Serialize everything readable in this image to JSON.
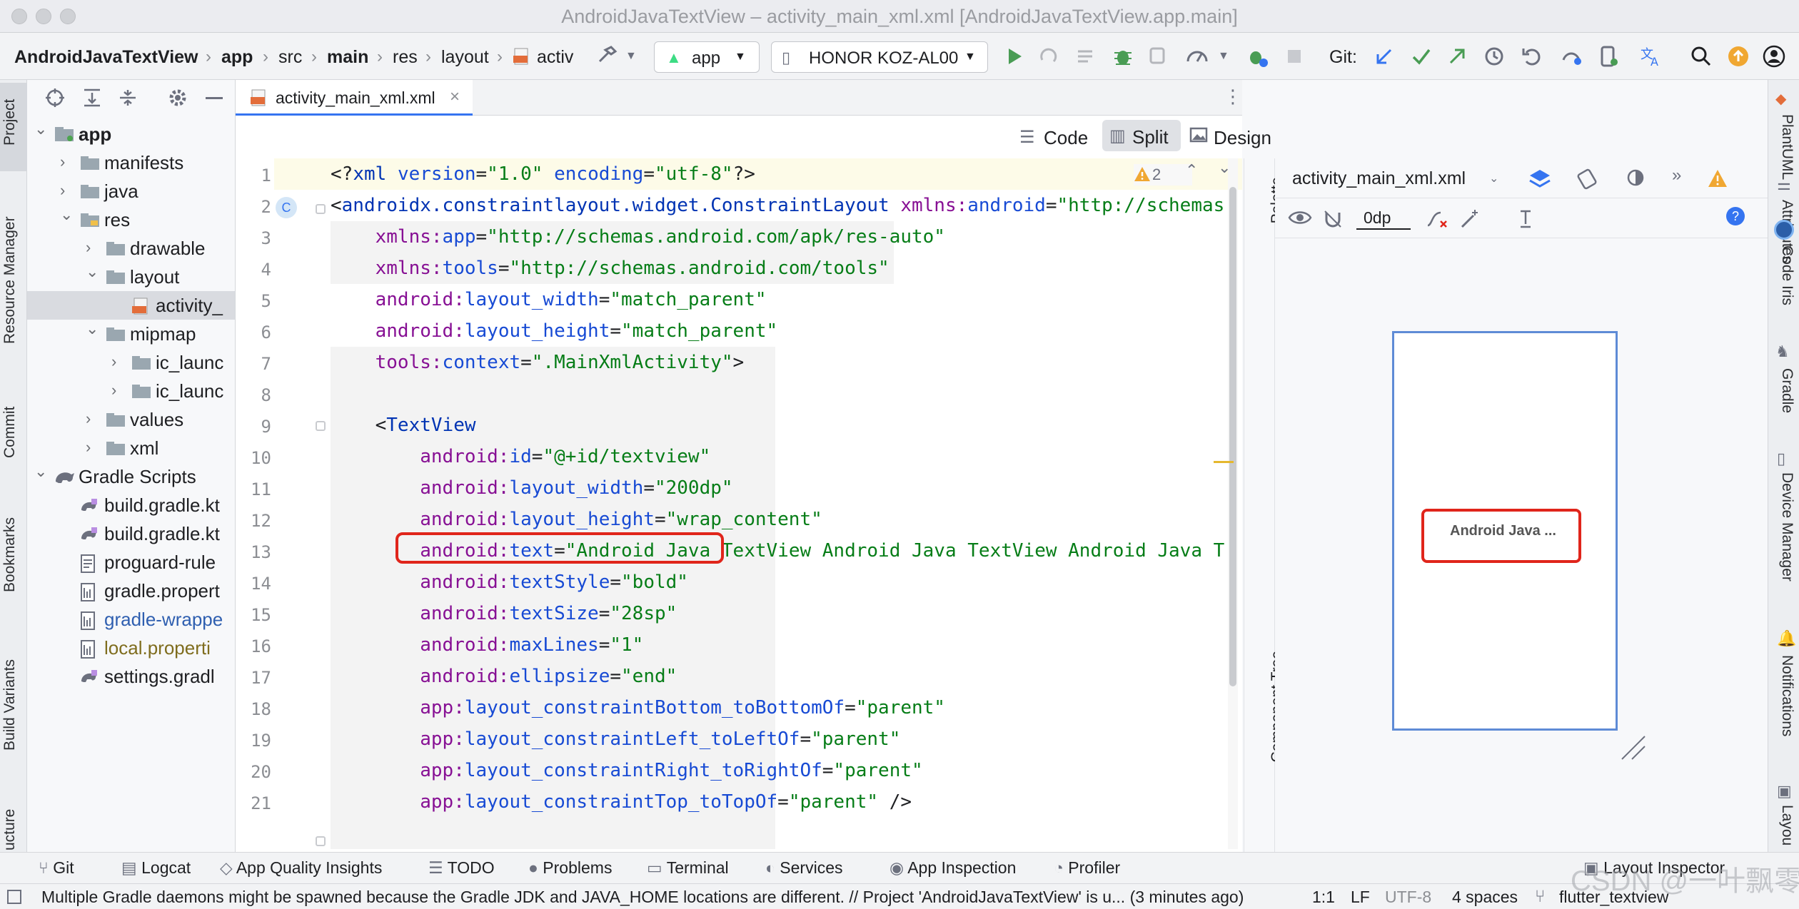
{
  "window": {
    "title": "AndroidJavaTextView – activity_main_xml.xml [AndroidJavaTextView.app.main]"
  },
  "toolbar": {
    "breadcrumbs": [
      "AndroidJavaTextView",
      "app",
      "src",
      "main",
      "res",
      "layout",
      "activ"
    ],
    "run_config": "app",
    "device": "HONOR KOZ-AL00",
    "git_label": "Git:"
  },
  "left_tools": [
    "Project",
    "Resource Manager",
    "Commit",
    "Bookmarks",
    "Build Variants",
    "ucture"
  ],
  "right_tools": [
    "PlantUML",
    "Attributes",
    "Code Iris",
    "Gradle",
    "Device Manager",
    "Notifications",
    "Layou"
  ],
  "project_tree": [
    {
      "label": "app",
      "depth": 0,
      "arrow": "down",
      "icon": "module-folder-icon",
      "bold": true
    },
    {
      "label": "manifests",
      "depth": 1,
      "arrow": "right",
      "icon": "folder-icon"
    },
    {
      "label": "java",
      "depth": 1,
      "arrow": "right",
      "icon": "folder-icon"
    },
    {
      "label": "res",
      "depth": 1,
      "arrow": "down",
      "icon": "res-folder-icon"
    },
    {
      "label": "drawable",
      "depth": 2,
      "arrow": "right",
      "icon": "folder-icon"
    },
    {
      "label": "layout",
      "depth": 2,
      "arrow": "down",
      "icon": "folder-icon"
    },
    {
      "label": "activity_",
      "depth": 3,
      "arrow": "",
      "icon": "xml-file-icon",
      "selected": true
    },
    {
      "label": "mipmap",
      "depth": 2,
      "arrow": "down",
      "icon": "folder-icon"
    },
    {
      "label": "ic_launc",
      "depth": 3,
      "arrow": "right",
      "icon": "folder-icon"
    },
    {
      "label": "ic_launc",
      "depth": 3,
      "arrow": "right",
      "icon": "folder-icon"
    },
    {
      "label": "values",
      "depth": 2,
      "arrow": "right",
      "icon": "folder-icon"
    },
    {
      "label": "xml",
      "depth": 2,
      "arrow": "right",
      "icon": "folder-icon"
    },
    {
      "label": "Gradle Scripts",
      "depth": 0,
      "arrow": "down",
      "icon": "gradle-icon"
    },
    {
      "label": "build.gradle.kt",
      "depth": 1,
      "arrow": "",
      "icon": "gradle-file-icon"
    },
    {
      "label": "build.gradle.kt",
      "depth": 1,
      "arrow": "",
      "icon": "gradle-file-icon"
    },
    {
      "label": "proguard-rule",
      "depth": 1,
      "arrow": "",
      "icon": "text-file-icon"
    },
    {
      "label": "gradle.propert",
      "depth": 1,
      "arrow": "",
      "icon": "properties-file-icon"
    },
    {
      "label": "gradle-wrappe",
      "depth": 1,
      "arrow": "",
      "icon": "properties-file-icon",
      "color": "#2f5fb0"
    },
    {
      "label": "local.properti",
      "depth": 1,
      "arrow": "",
      "icon": "properties-file-icon",
      "color": "#7f6d1e"
    },
    {
      "label": "settings.gradl",
      "depth": 1,
      "arrow": "",
      "icon": "gradle-file-icon"
    }
  ],
  "editor": {
    "tab_label": "activity_main_xml.xml",
    "view_modes": {
      "code": "Code",
      "split": "Split",
      "design": "Design"
    },
    "active_mode": "Split",
    "warning_count": "2",
    "lines": [
      [
        [
          "plain",
          "<?"
        ],
        [
          "tag",
          "xml "
        ],
        [
          "attr",
          "version"
        ],
        [
          "plain",
          "="
        ],
        [
          "val",
          "\"1.0\""
        ],
        [
          "attr",
          " encoding"
        ],
        [
          "plain",
          "="
        ],
        [
          "val",
          "\"utf-8\""
        ],
        [
          "plain",
          "?>"
        ]
      ],
      [
        [
          "plain",
          "<"
        ],
        [
          "tag",
          "androidx.constraintlayout.widget.ConstraintLayout "
        ],
        [
          "ns",
          "xmlns:"
        ],
        [
          "attr",
          "android"
        ],
        [
          "plain",
          "="
        ],
        [
          "val",
          "\"http://schemas"
        ]
      ],
      [
        [
          "plain",
          "    "
        ],
        [
          "ns",
          "xmlns:"
        ],
        [
          "attr",
          "app"
        ],
        [
          "plain",
          "="
        ],
        [
          "val",
          "\"http://schemas.android.com/apk/res-auto\""
        ]
      ],
      [
        [
          "plain",
          "    "
        ],
        [
          "ns",
          "xmlns:"
        ],
        [
          "attr",
          "tools"
        ],
        [
          "plain",
          "="
        ],
        [
          "val",
          "\"http://schemas.android.com/tools\""
        ]
      ],
      [
        [
          "plain",
          "    "
        ],
        [
          "ns",
          "android:"
        ],
        [
          "attr",
          "layout_width"
        ],
        [
          "plain",
          "="
        ],
        [
          "val",
          "\"match_parent\""
        ]
      ],
      [
        [
          "plain",
          "    "
        ],
        [
          "ns",
          "android:"
        ],
        [
          "attr",
          "layout_height"
        ],
        [
          "plain",
          "="
        ],
        [
          "val",
          "\"match_parent\""
        ]
      ],
      [
        [
          "plain",
          "    "
        ],
        [
          "ns",
          "tools:"
        ],
        [
          "attr",
          "context"
        ],
        [
          "plain",
          "="
        ],
        [
          "val",
          "\".MainXmlActivity\""
        ],
        [
          "plain",
          ">"
        ]
      ],
      [
        [
          "plain",
          ""
        ]
      ],
      [
        [
          "plain",
          "    <"
        ],
        [
          "tag",
          "TextView"
        ]
      ],
      [
        [
          "plain",
          "        "
        ],
        [
          "ns",
          "android:"
        ],
        [
          "attr",
          "id"
        ],
        [
          "plain",
          "="
        ],
        [
          "val",
          "\"@+id/textview\""
        ]
      ],
      [
        [
          "plain",
          "        "
        ],
        [
          "ns",
          "android:"
        ],
        [
          "attr",
          "layout_width"
        ],
        [
          "plain",
          "="
        ],
        [
          "val",
          "\"200dp\""
        ]
      ],
      [
        [
          "plain",
          "        "
        ],
        [
          "ns",
          "android:"
        ],
        [
          "attr",
          "layout_height"
        ],
        [
          "plain",
          "="
        ],
        [
          "val",
          "\"wrap_content\""
        ]
      ],
      [
        [
          "plain",
          "        "
        ],
        [
          "ns",
          "android:"
        ],
        [
          "attr",
          "text"
        ],
        [
          "plain",
          "="
        ],
        [
          "val",
          "\"Android Java TextView Android Java TextView Android Java T"
        ]
      ],
      [
        [
          "plain",
          "        "
        ],
        [
          "ns",
          "android:"
        ],
        [
          "attr",
          "textStyle"
        ],
        [
          "plain",
          "="
        ],
        [
          "val",
          "\"bold\""
        ]
      ],
      [
        [
          "plain",
          "        "
        ],
        [
          "ns",
          "android:"
        ],
        [
          "attr",
          "textSize"
        ],
        [
          "plain",
          "="
        ],
        [
          "val",
          "\"28sp\""
        ]
      ],
      [
        [
          "plain",
          "        "
        ],
        [
          "ns",
          "android:"
        ],
        [
          "attr",
          "maxLines"
        ],
        [
          "plain",
          "="
        ],
        [
          "val",
          "\"1\""
        ]
      ],
      [
        [
          "plain",
          "        "
        ],
        [
          "ns",
          "android:"
        ],
        [
          "attr",
          "ellipsize"
        ],
        [
          "plain",
          "="
        ],
        [
          "val",
          "\"end\""
        ]
      ],
      [
        [
          "plain",
          "        "
        ],
        [
          "ns",
          "app:"
        ],
        [
          "attr",
          "layout_constraintBottom_toBottomOf"
        ],
        [
          "plain",
          "="
        ],
        [
          "val",
          "\"parent\""
        ]
      ],
      [
        [
          "plain",
          "        "
        ],
        [
          "ns",
          "app:"
        ],
        [
          "attr",
          "layout_constraintLeft_toLeftOf"
        ],
        [
          "plain",
          "="
        ],
        [
          "val",
          "\"parent\""
        ]
      ],
      [
        [
          "plain",
          "        "
        ],
        [
          "ns",
          "app:"
        ],
        [
          "attr",
          "layout_constraintRight_toRightOf"
        ],
        [
          "plain",
          "="
        ],
        [
          "val",
          "\"parent\""
        ]
      ],
      [
        [
          "plain",
          "        "
        ],
        [
          "ns",
          "app:"
        ],
        [
          "attr",
          "layout_constraintTop_toTopOf"
        ],
        [
          "plain",
          "="
        ],
        [
          "val",
          "\"parent\""
        ],
        [
          "plain",
          " />"
        ]
      ]
    ]
  },
  "side_panels": {
    "palette": "Palette",
    "component_tree": "Component Tree"
  },
  "design": {
    "file_dropdown": "activity_main_xml.xml",
    "margin_value": "0dp",
    "preview_text": "Android Java ..."
  },
  "tool_windows": [
    "Git",
    "Logcat",
    "App Quality Insights",
    "TODO",
    "Problems",
    "Terminal",
    "Services",
    "App Inspection",
    "Profiler",
    "Layout Inspector"
  ],
  "status": {
    "message": "Multiple Gradle daemons might be spawned because the Gradle JDK and JAVA_HOME locations are different. // Project 'AndroidJavaTextView' is u... (3 minutes ago)",
    "position": "1:1",
    "line_sep": "LF",
    "encoding": "UTF-8",
    "indent": "4 spaces",
    "branch": "flutter_textview"
  },
  "watermark": "CSDN @一叶飘零"
}
